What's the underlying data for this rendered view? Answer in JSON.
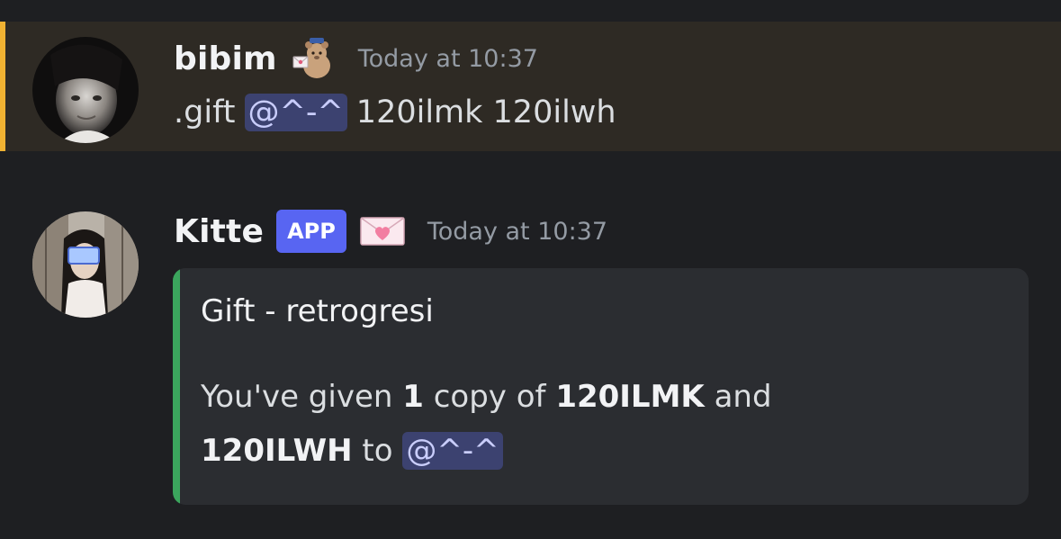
{
  "messages": [
    {
      "author": "bibim",
      "sticker_icon": "teddy-bear-mail-sticker",
      "timestamp": "Today at 10:37",
      "highlighted": true,
      "content": {
        "prefix": ".gift",
        "mention": "@^-^",
        "suffix": "120ilmk 120ilwh"
      }
    },
    {
      "author": "Kitte",
      "badge": "APP",
      "sticker_icon": "heart-letter-sticker",
      "timestamp": "Today at 10:37",
      "embed": {
        "title": "Gift - retrogresi",
        "desc_part1": "You've given",
        "desc_count": "1",
        "desc_part2": "copy of",
        "desc_item1": "120ILMK",
        "desc_part3": "and",
        "desc_item2": "120ILWH",
        "desc_part4": "to",
        "desc_mention": "@^-^"
      }
    }
  ],
  "colors": {
    "background": "#1e1f22",
    "highlight_bg": "#2e2a24",
    "mention_bar": "#f0b232",
    "mention_bg": "#3c4270",
    "app_badge": "#5865f2",
    "embed_bar": "#3ba55d"
  }
}
